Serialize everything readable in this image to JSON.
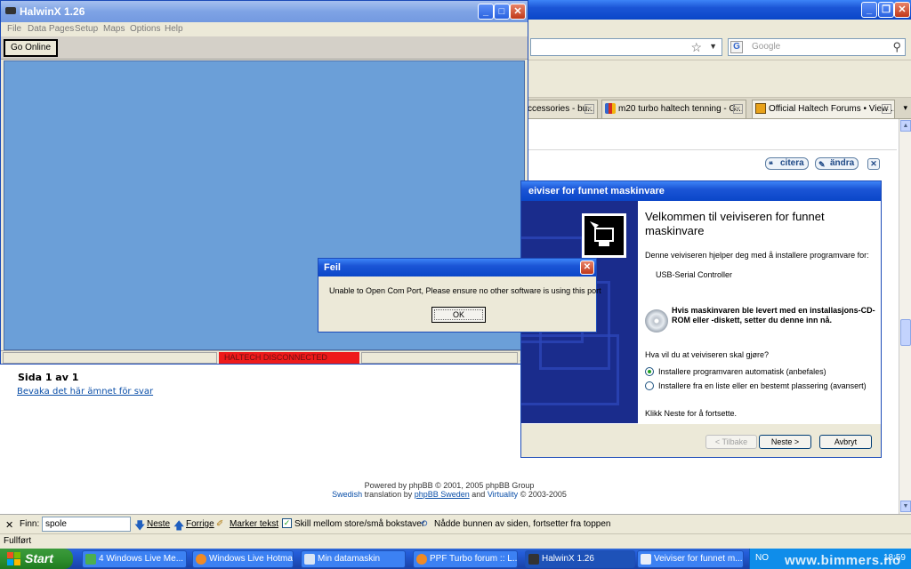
{
  "browser": {
    "search_placeholder": "Google",
    "tabs": [
      {
        "label": "ccessories - bu..."
      },
      {
        "label": "m20 turbo haltech tenning - G..."
      },
      {
        "label": "Official Haltech Forums • View ..."
      }
    ],
    "forum_buttons": {
      "quote": "citera",
      "edit": "ändra"
    },
    "page_count": "Sida 1 av 1",
    "watch_link": "Bevaka det här ämnet för svar",
    "powered_by": "Powered by phpBB © 2001, 2005 phpBB Group",
    "translation": {
      "lang": "Swedish",
      "mid": "translation by",
      "sweden": "phpBB Sweden",
      "and": "and",
      "virtuality": "Virtuality",
      "year": "© 2003-2005"
    },
    "status": "Fullført"
  },
  "findbar": {
    "label": "Finn:",
    "value": "spole",
    "next": "Neste",
    "prev": "Forrige",
    "highlight": "Marker tekst",
    "match_case": "Skill mellom store/små bokstaver",
    "wrapped": "Nådde bunnen av siden, fortsetter fra toppen"
  },
  "halwinx": {
    "title": "HalwinX 1.26",
    "menu": [
      "File",
      "Data Pages",
      "Setup",
      "Maps",
      "Options",
      "Help"
    ],
    "go_online": "Go Online",
    "status": "HALTECH DISCONNECTED"
  },
  "wizard": {
    "title": "eiviser for funnet maskinvare",
    "heading": "Velkommen til veiviseren for funnet maskinvare",
    "intro": "Denne veiviseren hjelper deg med å installere programvare for:",
    "device": "USB-Serial Controller",
    "cd_note": "Hvis maskinvaren ble levert med en installasjons-CD-ROM eller -diskett, setter du denne inn nå.",
    "question": "Hva vil du at veiviseren skal gjøre?",
    "option_auto": "Installere programvaren automatisk (anbefales)",
    "option_manual": "Installere fra en liste eller en bestemt plassering (avansert)",
    "continue": "Klikk Neste for å fortsette.",
    "back": "< Tilbake",
    "next": "Neste >",
    "cancel": "Avbryt"
  },
  "error_dialog": {
    "title": "Feil",
    "message": "Unable to Open Com Port, Please ensure no other software is using this port",
    "ok": "OK"
  },
  "taskbar": {
    "start": "Start",
    "tasks": [
      {
        "label": "4 Windows Live Me..."
      },
      {
        "label": "Windows Live Hotmai..."
      },
      {
        "label": "Min datamaskin"
      },
      {
        "label": "PPF Turbo forum :: L..."
      },
      {
        "label": "HalwinX 1.26"
      },
      {
        "label": "Veiviser for funnet m..."
      }
    ],
    "lang": "NO",
    "clock": "18:59"
  },
  "watermark": "www.bimmers.no"
}
